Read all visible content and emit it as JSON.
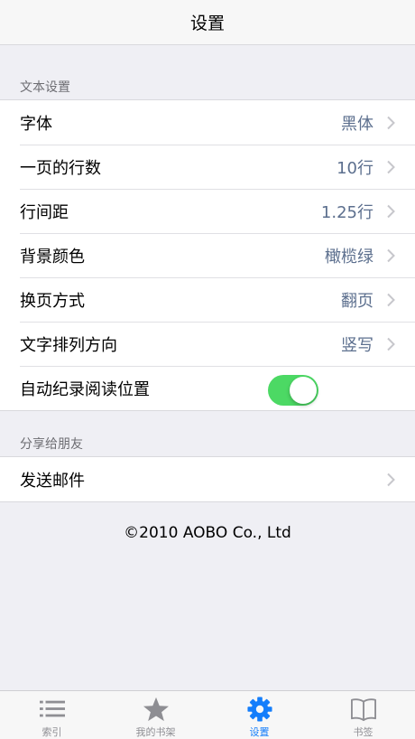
{
  "navbar": {
    "title": "设置"
  },
  "sections": {
    "text_settings": {
      "header": "文本设置",
      "rows": [
        {
          "label": "字体",
          "value": "黑体"
        },
        {
          "label": "一页的行数",
          "value": "10行"
        },
        {
          "label": "行间距",
          "value": "1.25行"
        },
        {
          "label": "背景颜色",
          "value": "橄榄绿"
        },
        {
          "label": "换页方式",
          "value": "翻页"
        },
        {
          "label": "文字排列方向",
          "value": "竖写"
        },
        {
          "label": "自动纪录阅读位置",
          "toggle_on": true
        }
      ]
    },
    "share": {
      "header": "分享给朋友",
      "rows": [
        {
          "label": "发送邮件"
        }
      ]
    }
  },
  "footer": {
    "copyright": "©2010 AOBO Co., Ltd"
  },
  "tabbar": {
    "active": "设置",
    "tabs": [
      {
        "label": "索引",
        "icon": "list-icon"
      },
      {
        "label": "我的书架",
        "icon": "star-icon"
      },
      {
        "label": "设置",
        "icon": "gear-icon"
      },
      {
        "label": "书签",
        "icon": "book-icon"
      }
    ]
  },
  "colors": {
    "accent": "#147efb",
    "value_text": "#5c6f8e",
    "toggle_on": "#4cd964",
    "background": "#efeff4"
  }
}
